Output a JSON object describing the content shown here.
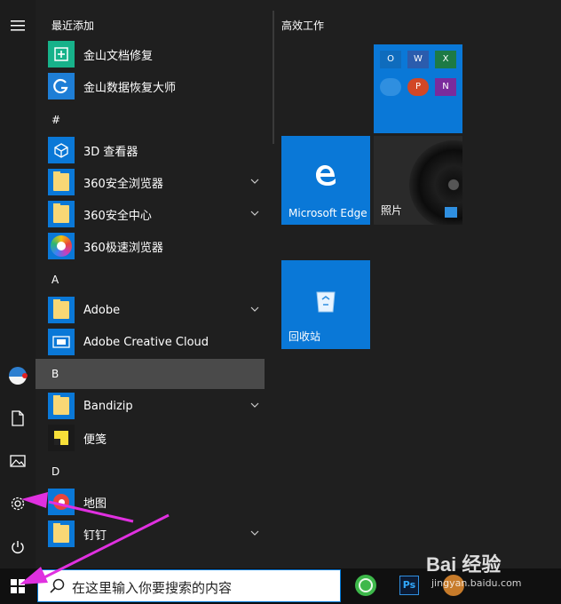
{
  "rail": {
    "items": [
      {
        "name": "hamburger-menu-icon"
      },
      {
        "name": "user-avatar"
      },
      {
        "name": "documents-icon"
      },
      {
        "name": "pictures-icon"
      },
      {
        "name": "settings-gear-icon"
      },
      {
        "name": "power-icon"
      }
    ]
  },
  "applist": {
    "recent_header": "最近添加",
    "recent": [
      {
        "label": "金山文档修复",
        "icon": "document-repair-icon"
      },
      {
        "label": "金山数据恢复大师",
        "icon": "data-recovery-icon"
      }
    ],
    "sections": [
      {
        "letter": "#",
        "items": [
          {
            "label": "3D 查看器",
            "icon": "3d-cube-icon"
          },
          {
            "label": "360安全浏览器",
            "icon": "folder-icon",
            "expandable": true
          },
          {
            "label": "360安全中心",
            "icon": "folder-icon",
            "expandable": true
          },
          {
            "label": "360极速浏览器",
            "icon": "colorful-browser-icon"
          }
        ]
      },
      {
        "letter": "A",
        "items": [
          {
            "label": "Adobe",
            "icon": "folder-icon",
            "expandable": true
          },
          {
            "label": "Adobe Creative Cloud",
            "icon": "creative-cloud-icon"
          }
        ]
      },
      {
        "letter": "B",
        "items": [
          {
            "label": "Bandizip",
            "icon": "folder-icon",
            "expandable": true
          },
          {
            "label": "便笺",
            "icon": "sticky-notes-icon"
          }
        ]
      },
      {
        "letter": "D",
        "items": [
          {
            "label": "地图",
            "icon": "maps-icon"
          },
          {
            "label": "钉钉",
            "icon": "folder-icon",
            "expandable": true
          }
        ]
      }
    ]
  },
  "tiles": {
    "group_title": "高效工作",
    "office_apps": [
      "O",
      "W",
      "X",
      "",
      "P",
      "N"
    ],
    "edge_label": "Microsoft Edge",
    "photos_label": "照片",
    "recycle_label": "回收站"
  },
  "taskbar": {
    "search_placeholder": "在这里输入你要搜索的内容",
    "ps_label": "Ps"
  },
  "watermark": {
    "text": "Bai 经验",
    "sub": "jingyan.baidu.com"
  },
  "colors": {
    "accent": "#0a78d7",
    "arrow": "#e030e0"
  }
}
